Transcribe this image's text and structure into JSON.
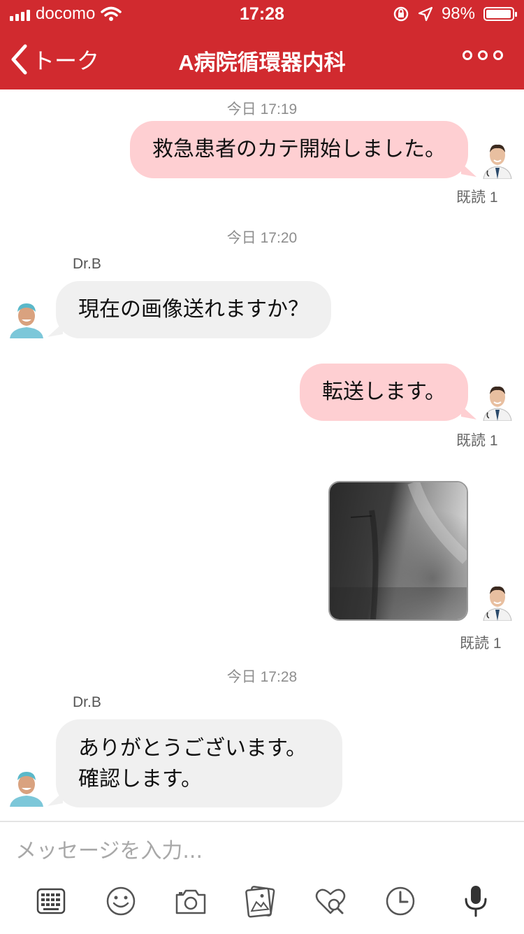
{
  "status_bar": {
    "carrier": "docomo",
    "time": "17:28",
    "battery": "98%",
    "battery_level": 0.98
  },
  "header": {
    "back_label": "トーク",
    "title": "A病院循環器内科"
  },
  "messages": [
    {
      "timestamp": "今日 17:19",
      "text": "救急患者のカテ開始しました。",
      "read": "既読 1"
    },
    {
      "timestamp": "今日 17:20",
      "sender": "Dr.B",
      "text": "現在の画像送れますか？"
    },
    {
      "text": "転送します。",
      "read": "既読 1"
    },
    {
      "type": "image",
      "read": "既読 1"
    },
    {
      "timestamp": "今日 17:28",
      "sender": "Dr.B",
      "line1": "ありがとうございます。",
      "line2": "確認します。"
    }
  ],
  "composer": {
    "placeholder": "メッセージを入力...",
    "tools": [
      "keyboard-icon",
      "smiley-icon",
      "camera-icon",
      "gallery-icon",
      "heart-search-icon",
      "clock-icon",
      "microphone-icon"
    ]
  },
  "colors": {
    "brand_red": "#d12a2f",
    "outgoing_bubble": "#fecfd2",
    "incoming_bubble": "#f0f0f0"
  }
}
